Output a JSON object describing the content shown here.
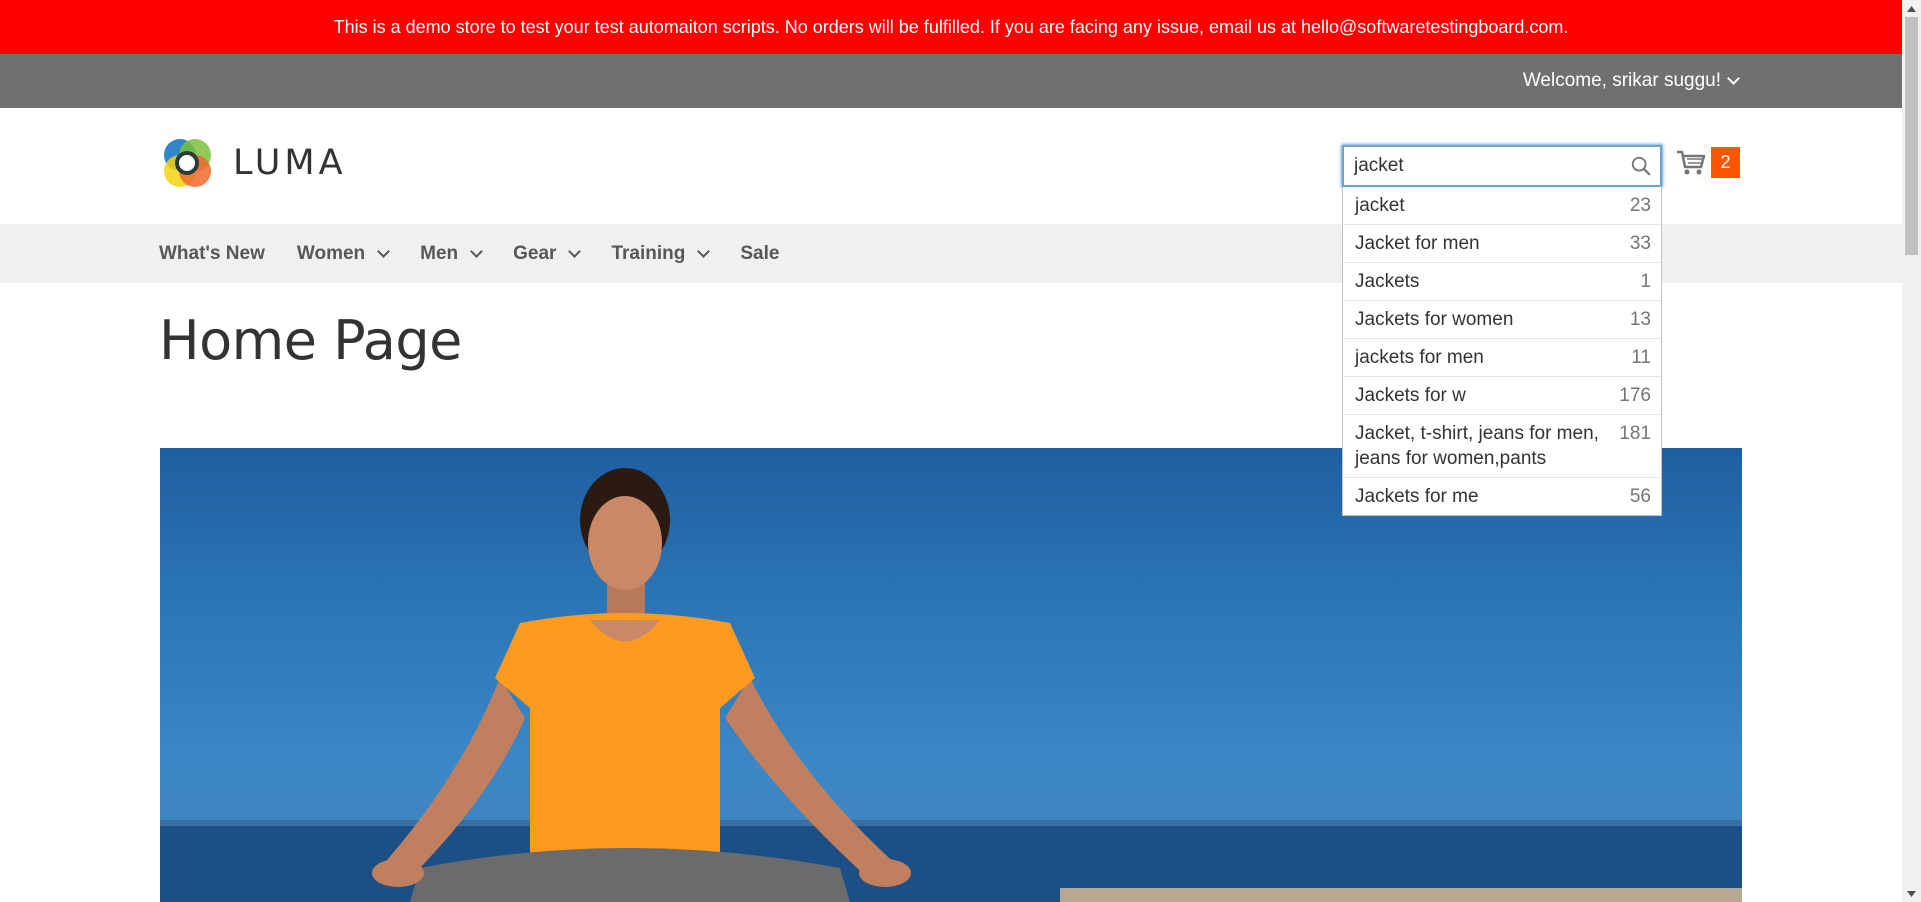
{
  "banner": {
    "text": "This is a demo store to test your test automaiton scripts. No orders will be fulfilled. If you are facing any issue, email us at hello@softwaretestingboard.com."
  },
  "header": {
    "welcome": "Welcome, srikar suggu!",
    "logo_text": "LUMA",
    "cart_count": "2"
  },
  "search": {
    "value": "jacket",
    "suggestions": [
      {
        "term": "jacket",
        "count": "23"
      },
      {
        "term": "Jacket for men",
        "count": "33"
      },
      {
        "term": "Jackets",
        "count": "1"
      },
      {
        "term": "Jackets for women",
        "count": "13"
      },
      {
        "term": "jackets for men",
        "count": "11"
      },
      {
        "term": "Jackets for w",
        "count": "176"
      },
      {
        "term": "Jacket, t-shirt, jeans for men, jeans for women,pants",
        "count": "181"
      },
      {
        "term": "Jackets for me",
        "count": "56"
      }
    ]
  },
  "nav": {
    "items": [
      {
        "label": "What's New"
      },
      {
        "label": "Women"
      },
      {
        "label": "Men"
      },
      {
        "label": "Gear"
      },
      {
        "label": "Training"
      },
      {
        "label": "Sale"
      }
    ]
  },
  "page": {
    "title": "Home Page"
  },
  "colors": {
    "banner_bg": "#ff0000",
    "panel_bg": "#6e716e",
    "nav_bg": "#f0f0f0",
    "cart_badge": "#ff5501",
    "search_focus": "#68a8e0"
  }
}
